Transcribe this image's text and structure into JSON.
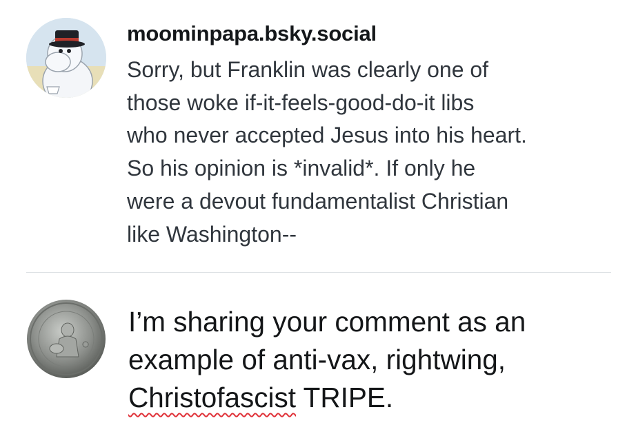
{
  "reply_post": {
    "avatar_icon": "moomin-character-avatar",
    "handle": "moominpapa.bsky.social",
    "body_lines": [
      "Sorry, but Franklin was clearly one of",
      "those woke if-it-feels-good-do-it libs",
      "who never accepted Jesus into his heart.",
      "So his opinion is *invalid*. If only he",
      "were a devout fundamentalist Christian",
      "like Washington--"
    ]
  },
  "compose": {
    "avatar_icon": "quarter-dollar-coin-avatar",
    "text_lines": [
      "I’m sharing your comment as an",
      "example of anti-vax, rightwing,"
    ],
    "last_line": {
      "misspelled_word": "Christofascist",
      "rest": " TRIPE."
    },
    "spellcheck_color": "#e0333a"
  }
}
